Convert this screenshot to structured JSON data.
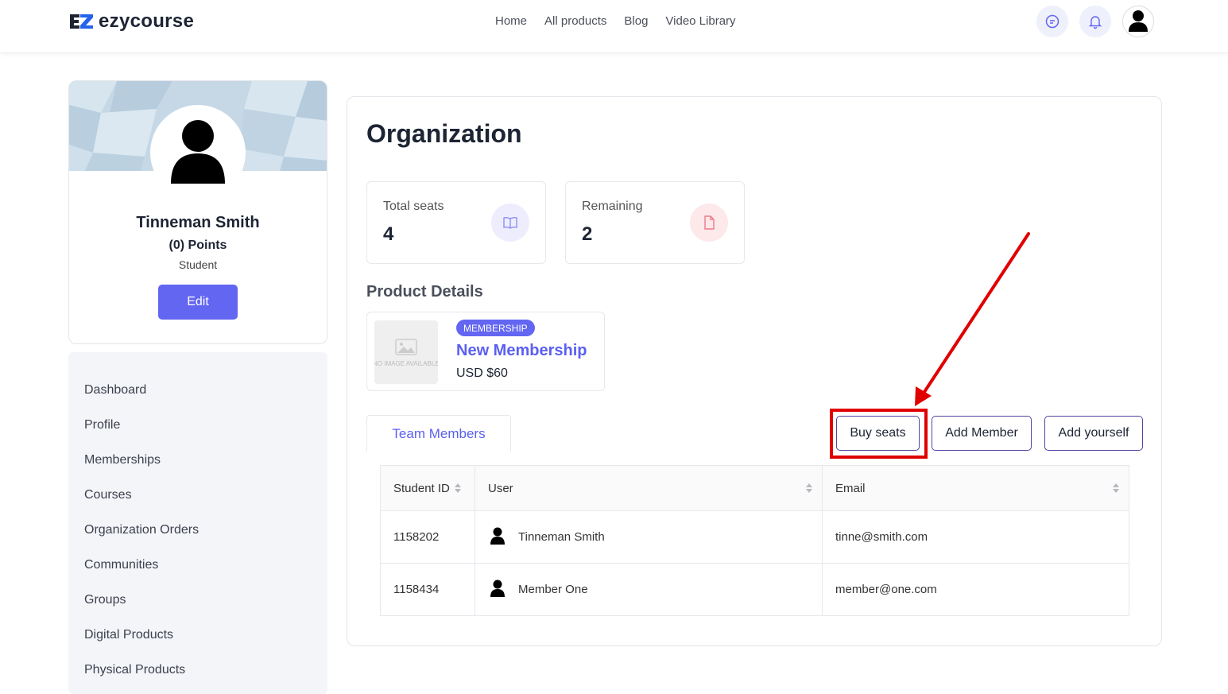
{
  "header": {
    "brand": "ezycourse",
    "nav": [
      "Home",
      "All products",
      "Blog",
      "Video Library"
    ]
  },
  "profile": {
    "name": "Tinneman Smith",
    "points": "(0) Points",
    "role": "Student",
    "edit_label": "Edit"
  },
  "sidebar": {
    "items": [
      "Dashboard",
      "Profile",
      "Memberships",
      "Courses",
      "Organization Orders",
      "Communities",
      "Groups",
      "Digital Products",
      "Physical Products"
    ]
  },
  "main": {
    "title": "Organization",
    "stats": [
      {
        "label": "Total seats",
        "value": "4"
      },
      {
        "label": "Remaining",
        "value": "2"
      }
    ],
    "product_section_title": "Product Details",
    "product": {
      "thumb_text": "NO IMAGE AVAILABLE",
      "badge": "MEMBERSHIP",
      "name": "New Membership",
      "price": "USD $60"
    },
    "tab_label": "Team Members",
    "buttons": {
      "buy_seats": "Buy seats",
      "add_member": "Add Member",
      "add_yourself": "Add yourself"
    },
    "table": {
      "headers": [
        "Student ID",
        "User",
        "Email"
      ],
      "rows": [
        {
          "id": "1158202",
          "user": "Tinneman Smith",
          "email": "tinne@smith.com"
        },
        {
          "id": "1158434",
          "user": "Member One",
          "email": "member@one.com"
        }
      ]
    }
  },
  "colors": {
    "accent": "#6366f1",
    "highlight": "#e00000"
  }
}
